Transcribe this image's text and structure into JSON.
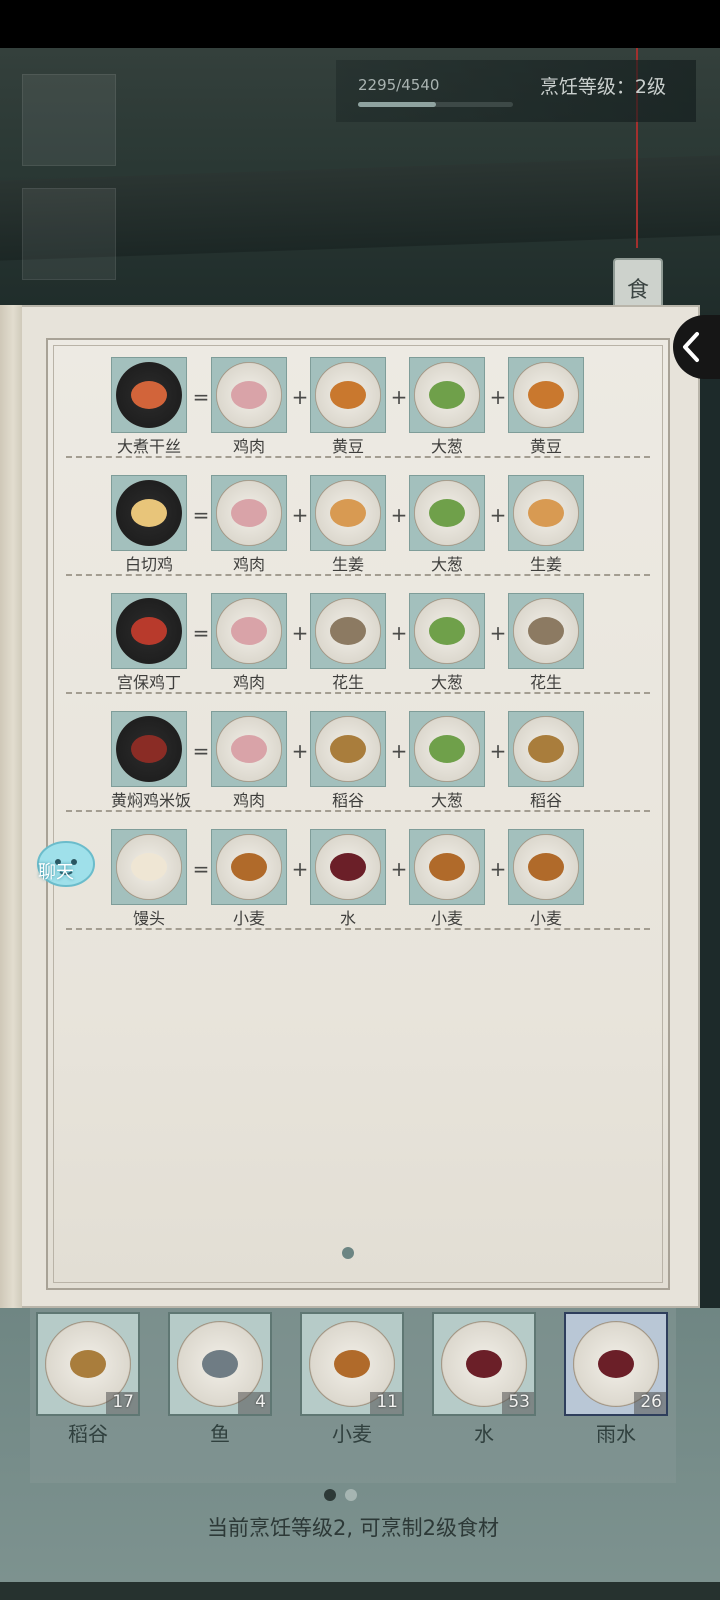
{
  "header": {
    "xp_text": "2295/4540",
    "xp_progress": 0.506,
    "level_text": "烹饪等级：2级",
    "tab_label": "食"
  },
  "recipes": [
    {
      "dish": "大煮干丝",
      "ingredients": [
        "鸡肉",
        "黄豆",
        "大葱",
        "黄豆"
      ]
    },
    {
      "dish": "白切鸡",
      "ingredients": [
        "鸡肉",
        "生姜",
        "大葱",
        "生姜"
      ]
    },
    {
      "dish": "宫保鸡丁",
      "ingredients": [
        "鸡肉",
        "花生",
        "大葱",
        "花生"
      ]
    },
    {
      "dish": "黄焖鸡米饭",
      "ingredients": [
        "鸡肉",
        "稻谷",
        "大葱",
        "稻谷"
      ]
    },
    {
      "dish": "馒头",
      "ingredients": [
        "小麦",
        "水",
        "小麦",
        "小麦"
      ]
    }
  ],
  "operators": {
    "equals": "=",
    "plus": "+"
  },
  "chat": {
    "label": "聊天"
  },
  "inventory": {
    "items": [
      {
        "label": "稻谷",
        "count": "17"
      },
      {
        "label": "鱼",
        "count": "4"
      },
      {
        "label": "小麦",
        "count": "11"
      },
      {
        "label": "水",
        "count": "53"
      },
      {
        "label": "雨水",
        "count": "26"
      }
    ]
  },
  "footer": {
    "text": "当前烹饪等级2, 可烹制2级食材"
  },
  "colors": {
    "ingredient_bg": "#a3c0bd",
    "page_bg": "#e7e3da",
    "xp_fill": "#8fa3a0",
    "active_dot": "#2d3937"
  }
}
